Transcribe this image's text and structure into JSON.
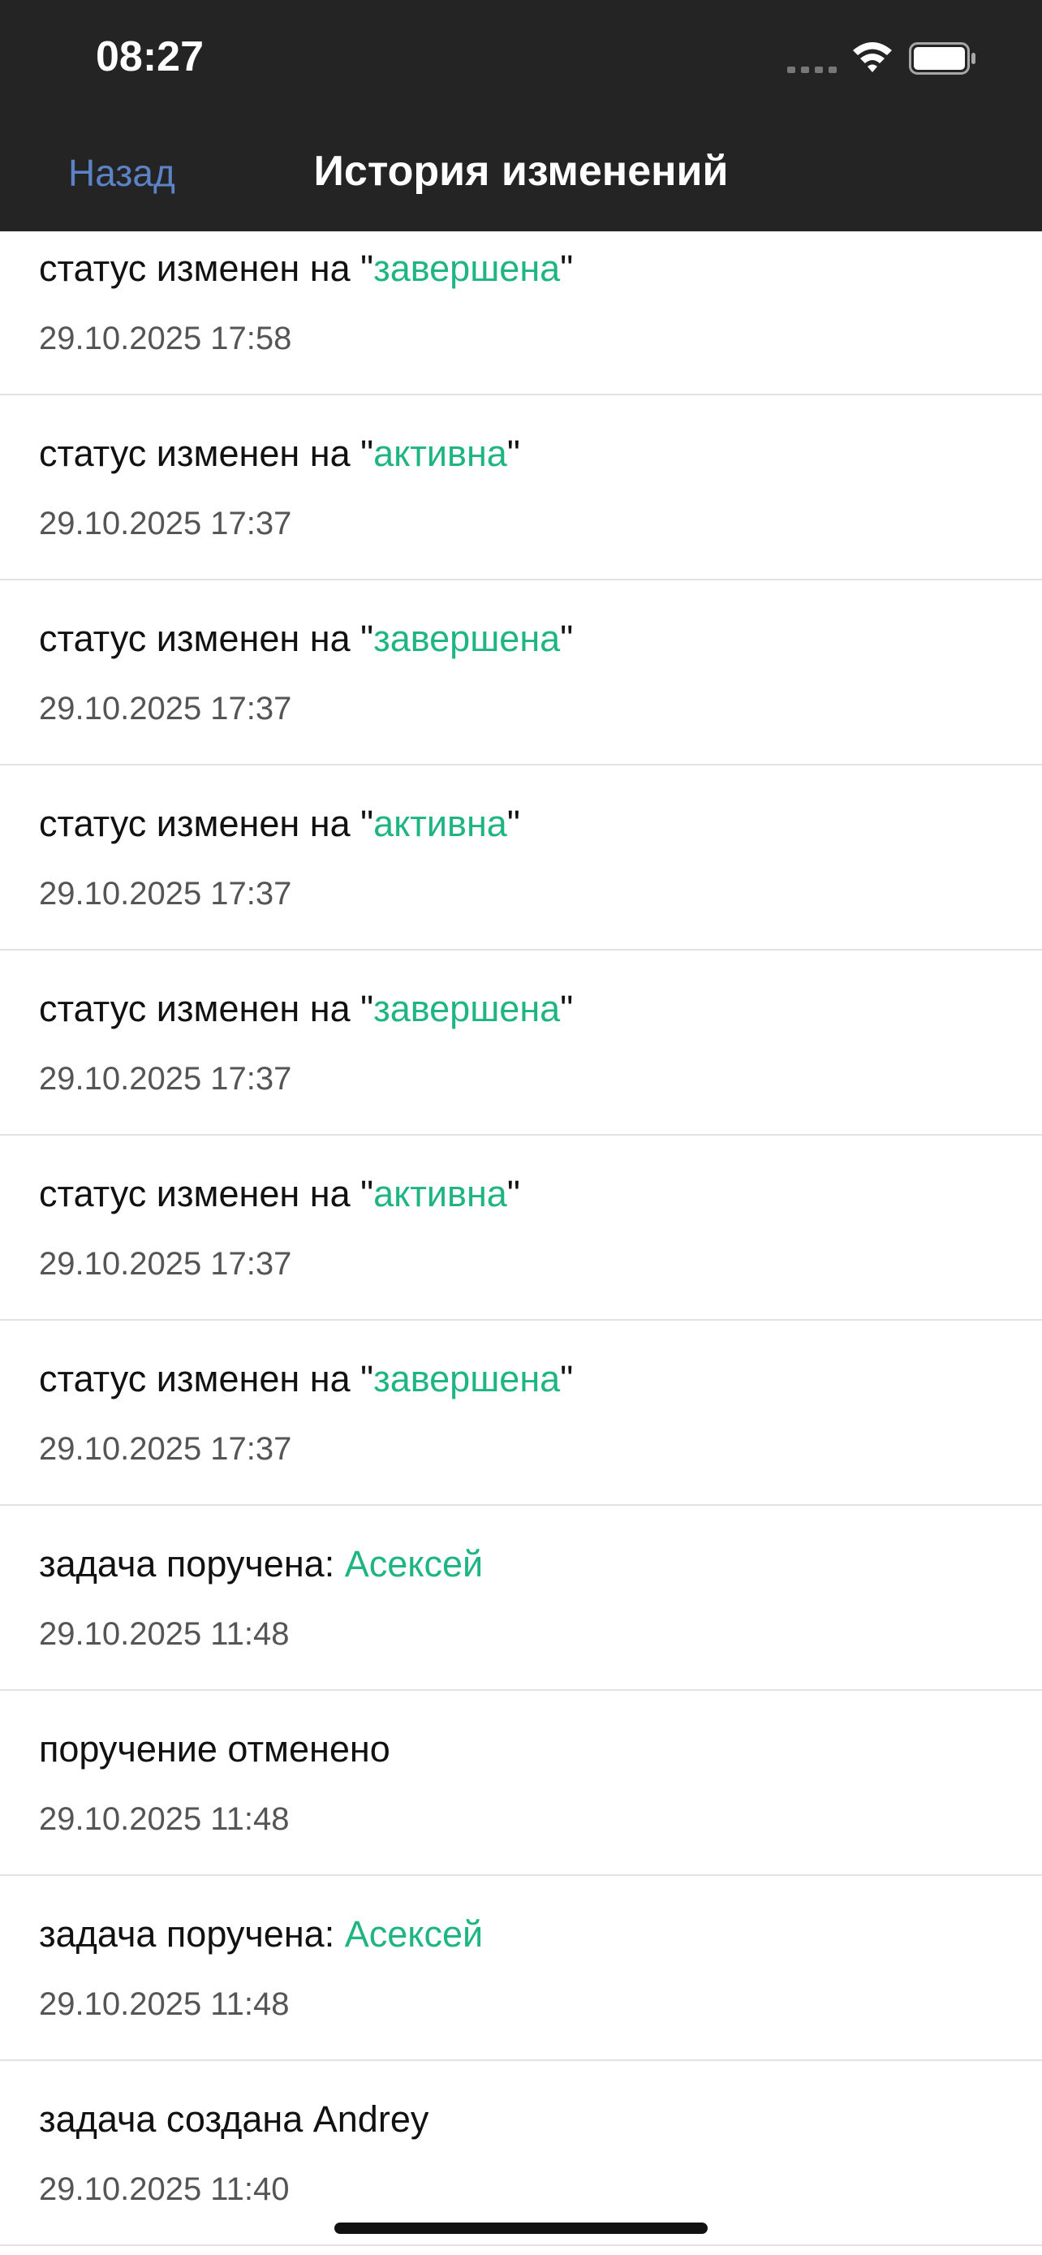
{
  "status_bar": {
    "time": "08:27",
    "signal_icon": "signal-dots-icon",
    "wifi_icon": "wifi-icon",
    "battery_icon": "battery-icon"
  },
  "nav": {
    "back_label": "Назад",
    "title": "История изменений"
  },
  "colors": {
    "accent": "#1fb583",
    "link": "#5d83c7",
    "topbar": "#242424"
  },
  "history": [
    {
      "prefix": "статус изменен на \"",
      "highlight": "завершена",
      "suffix": "\"",
      "date": "29.10.2025 17:58"
    },
    {
      "prefix": "статус изменен на \"",
      "highlight": "активна",
      "suffix": "\"",
      "date": "29.10.2025 17:37"
    },
    {
      "prefix": "статус изменен на \"",
      "highlight": "завершена",
      "suffix": "\"",
      "date": "29.10.2025 17:37"
    },
    {
      "prefix": "статус изменен на \"",
      "highlight": "активна",
      "suffix": "\"",
      "date": "29.10.2025 17:37"
    },
    {
      "prefix": "статус изменен на \"",
      "highlight": "завершена",
      "suffix": "\"",
      "date": "29.10.2025 17:37"
    },
    {
      "prefix": "статус изменен на \"",
      "highlight": "активна",
      "suffix": "\"",
      "date": "29.10.2025 17:37"
    },
    {
      "prefix": "статус изменен на \"",
      "highlight": "завершена",
      "suffix": "\"",
      "date": "29.10.2025 17:37"
    },
    {
      "prefix": "задача поручена: ",
      "highlight": "Асексей",
      "suffix": "",
      "date": "29.10.2025 11:48"
    },
    {
      "prefix": "поручение отменено",
      "highlight": "",
      "suffix": "",
      "date": "29.10.2025 11:48"
    },
    {
      "prefix": "задача поручена: ",
      "highlight": "Асексей",
      "suffix": "",
      "date": "29.10.2025 11:48"
    },
    {
      "prefix": "задача создана Andrey",
      "highlight": "",
      "suffix": "",
      "date": "29.10.2025 11:40"
    }
  ]
}
